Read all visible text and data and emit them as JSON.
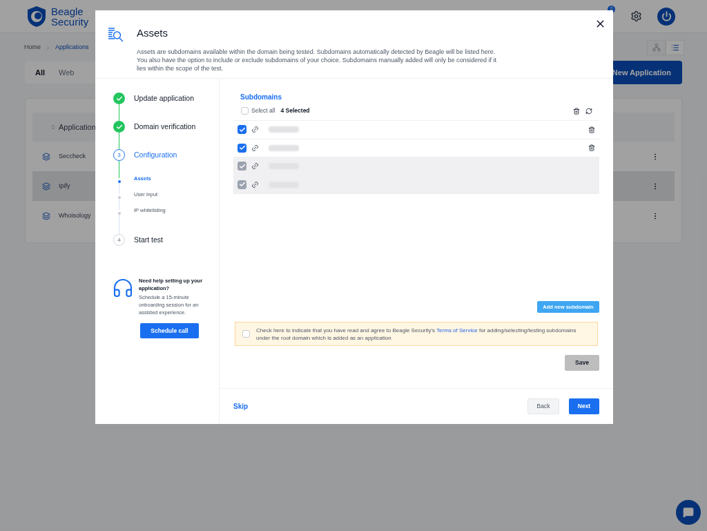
{
  "brand": {
    "line1": "Beagle",
    "line2": "Security"
  },
  "header": {
    "notification_count": "2"
  },
  "breadcrumb": [
    {
      "label": "Home",
      "selected": false
    },
    {
      "label": "Applications",
      "selected": true
    }
  ],
  "filter_tabs": [
    {
      "label": "All",
      "selected": true
    },
    {
      "label": "Web",
      "selected": false
    }
  ],
  "new_application_button": "New Application",
  "view_toggle": [
    {
      "kind": "tree",
      "selected": false
    },
    {
      "kind": "list",
      "selected": true
    }
  ],
  "table": {
    "column_header": "Application",
    "rows": [
      {
        "name": "Seccheck",
        "shaded": false
      },
      {
        "name": "Ipify",
        "shaded": true
      },
      {
        "name": "Whoisology",
        "shaded": false
      }
    ]
  },
  "modal": {
    "title": "Assets",
    "description": "Assets are subdomains available within the domain being tested. Subdomains automatically detected by Beagle will be listed here. You also have the option to include or exclude subdomains of your choice. Subdomains manually added will only be considered if it lies within the scope of the test.",
    "steps": [
      {
        "label": "Update application",
        "done": true,
        "current": false
      },
      {
        "label": "Domain verification",
        "done": true,
        "current": false
      },
      {
        "label": "Configuration",
        "number": "3",
        "done": false,
        "current": true,
        "children": [
          {
            "label": "Assets",
            "selected": true
          },
          {
            "label": "User input",
            "selected": false
          },
          {
            "label": "IP whitelisting",
            "selected": false
          }
        ]
      },
      {
        "label": "Start test",
        "number": "4",
        "done": false,
        "current": false
      }
    ],
    "help": {
      "title": "Need help setting up your application?",
      "text": "Schedule a 15-minute onboarding session for an assisted experience.",
      "button": "Schedule call"
    },
    "subdomains": {
      "heading": "Subdomains",
      "select_all": {
        "label": "Select all",
        "checked": false
      },
      "selected_count": "4 Selected",
      "rows": [
        {
          "checked": true,
          "disabled": false
        },
        {
          "checked": true,
          "disabled": false
        },
        {
          "checked": true,
          "disabled": true
        },
        {
          "checked": true,
          "disabled": true
        }
      ]
    },
    "add_button": "Add new subdomain",
    "agreement": {
      "checked": false,
      "before": "Check here to indicate that you have read and agree to Beagle Security's",
      "link": "Terms of Service",
      "after": "for adding/selecting/testing subdomains under the root domain which is added as an application"
    },
    "save_button": "Save",
    "skip_link": "Skip",
    "back_button": "Back",
    "next_button": "Next"
  }
}
